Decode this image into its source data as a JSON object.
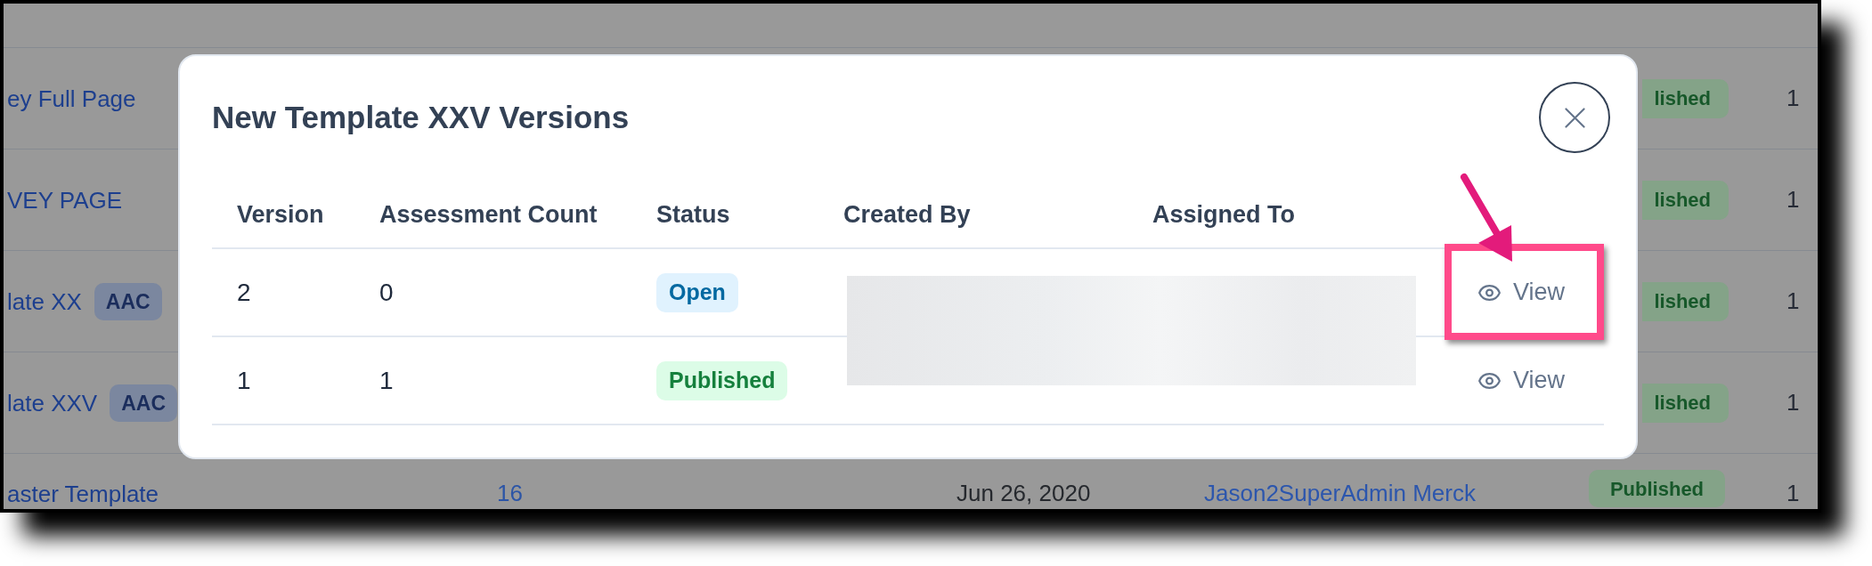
{
  "background_table": {
    "rows": [
      {
        "name": "ey Full Page",
        "status": {
          "label": "lished",
          "kind": "partial"
        },
        "column_6": "1"
      },
      {
        "name": "VEY PAGE",
        "status": {
          "label": "lished",
          "kind": "partial"
        },
        "column_6": "1"
      },
      {
        "name": "late XX",
        "tag": "AAC",
        "status": {
          "label": "lished",
          "kind": "partial"
        },
        "column_6": "1"
      },
      {
        "name": "late XXV",
        "tag": "AAC",
        "status": {
          "label": "lished",
          "kind": "partial"
        },
        "column_6": "1"
      },
      {
        "name": "aster Template",
        "column_2": "16",
        "column_3": "Jun 26, 2020",
        "column_4": "Jason2SuperAdmin Merck",
        "status": {
          "label": "Published",
          "kind": "full"
        },
        "column_6": "1"
      }
    ]
  },
  "dialog": {
    "title": "New Template XXV Versions",
    "columns": [
      "Version",
      "Assessment Count",
      "Status",
      "Created By",
      "Assigned To"
    ],
    "rows": [
      {
        "version": "2",
        "assessment_count": "0",
        "status": {
          "label": "Open",
          "kind": "open"
        },
        "action": "View",
        "highlighted": true
      },
      {
        "version": "1",
        "assessment_count": "1",
        "status": {
          "label": "Published",
          "kind": "published"
        },
        "action": "View",
        "highlighted": false
      }
    ]
  }
}
